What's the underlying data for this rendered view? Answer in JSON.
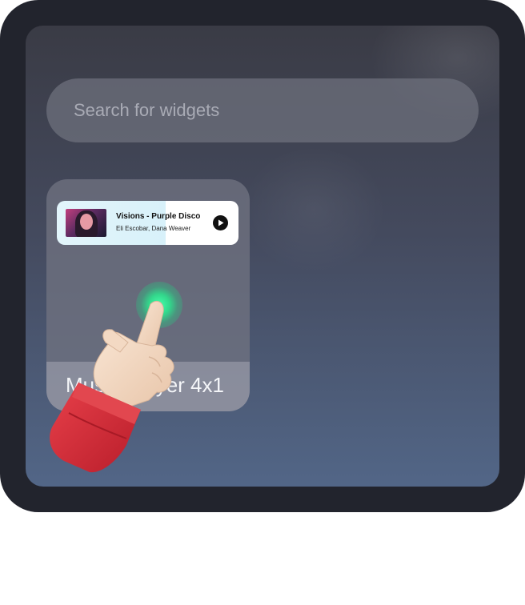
{
  "search": {
    "placeholder": "Search for widgets"
  },
  "widget": {
    "label": "Music Player 4x1"
  },
  "player": {
    "title": "Visions - Purple Disco",
    "artist": "Eli Escobar, Dana Weaver"
  },
  "colors": {
    "device_frame": "#22242d",
    "screen_top": "#3a3b45",
    "screen_bottom": "#526687",
    "tap_indicator": "#44ffaa",
    "sleeve": "#d42a35",
    "hand": "#f1d8c4"
  },
  "icons": {
    "play": "play-icon",
    "cursor": "pointing-hand-icon"
  }
}
